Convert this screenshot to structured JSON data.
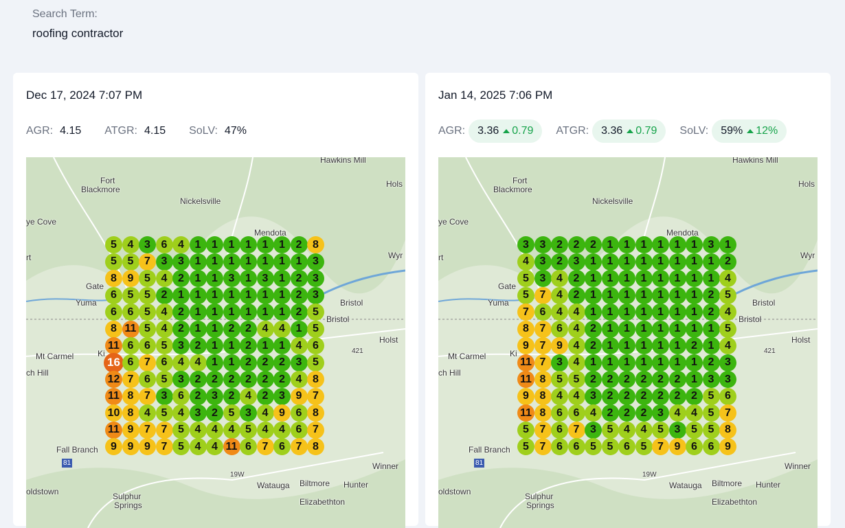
{
  "search": {
    "label": "Search Term:",
    "value": "roofing contractor"
  },
  "colors": {
    "rank_1_3": "#3cb50f",
    "rank_4_6": "#9fcf1c",
    "rank_7_10": "#f6c21a",
    "rank_11_15": "#f08a17",
    "rank_16_plus": "#e56417",
    "delta_up": "#16a34a",
    "pill_bg": "#e8f6ee"
  },
  "places": [
    "Hawkins Mill",
    "Hols",
    "Fort",
    "Blackmore",
    "Nickelsville",
    "ye Cove",
    "Mendota",
    "rt",
    "Wyr",
    "Gate",
    "Yuma",
    "Bristol",
    "Bristol",
    "Holst",
    "Mt Carmel",
    "Ki",
    "ch Hill",
    "421",
    "Fall Branch",
    "81",
    "19W",
    "Winner",
    "oldstown",
    "Watauga",
    "Biltmore",
    "Hunter",
    "Sulphur",
    "Springs",
    "Elizabethton"
  ],
  "scans": [
    {
      "date": "Dec 17, 2024 7:07 PM",
      "metrics": {
        "agr_label": "AGR:",
        "agr": "4.15",
        "atgr_label": "ATGR:",
        "atgr": "4.15",
        "solv_label": "SoLV:",
        "solv": "47%"
      },
      "grid": [
        [
          5,
          4,
          3,
          6,
          4,
          1,
          1,
          1,
          1,
          1,
          1,
          2,
          8
        ],
        [
          5,
          5,
          7,
          3,
          3,
          1,
          1,
          1,
          1,
          1,
          1,
          1,
          3
        ],
        [
          8,
          9,
          5,
          4,
          2,
          1,
          1,
          3,
          1,
          3,
          1,
          2,
          3
        ],
        [
          6,
          5,
          5,
          2,
          1,
          1,
          1,
          1,
          1,
          1,
          1,
          2,
          3
        ],
        [
          6,
          6,
          5,
          4,
          2,
          1,
          1,
          1,
          1,
          1,
          1,
          2,
          5
        ],
        [
          8,
          11,
          5,
          4,
          2,
          1,
          1,
          2,
          2,
          4,
          4,
          1,
          5
        ],
        [
          11,
          6,
          6,
          5,
          3,
          2,
          1,
          1,
          2,
          1,
          1,
          4,
          6
        ],
        [
          16,
          6,
          7,
          6,
          4,
          4,
          1,
          1,
          2,
          2,
          2,
          3,
          5
        ],
        [
          12,
          7,
          6,
          5,
          3,
          2,
          2,
          2,
          2,
          2,
          2,
          4,
          8
        ],
        [
          11,
          8,
          7,
          3,
          6,
          2,
          3,
          2,
          4,
          2,
          3,
          9,
          7
        ],
        [
          10,
          8,
          4,
          5,
          4,
          3,
          2,
          5,
          3,
          4,
          9,
          6,
          8
        ],
        [
          11,
          9,
          7,
          7,
          5,
          4,
          4,
          4,
          5,
          4,
          4,
          6,
          7
        ],
        [
          9,
          9,
          9,
          7,
          5,
          4,
          4,
          11,
          6,
          7,
          6,
          7,
          8
        ]
      ]
    },
    {
      "date": "Jan 14, 2025 7:06 PM",
      "metrics": {
        "agr_label": "AGR:",
        "agr": "3.36",
        "agr_delta": "0.79",
        "atgr_label": "ATGR:",
        "atgr": "3.36",
        "atgr_delta": "0.79",
        "solv_label": "SoLV:",
        "solv": "59%",
        "solv_delta": "12%"
      },
      "grid": [
        [
          3,
          3,
          2,
          2,
          2,
          1,
          1,
          1,
          1,
          1,
          1,
          3,
          1
        ],
        [
          4,
          3,
          2,
          3,
          1,
          1,
          1,
          1,
          1,
          1,
          1,
          1,
          2
        ],
        [
          5,
          3,
          4,
          2,
          1,
          1,
          1,
          1,
          1,
          1,
          1,
          1,
          4
        ],
        [
          5,
          7,
          4,
          2,
          1,
          1,
          1,
          1,
          1,
          1,
          1,
          2,
          5
        ],
        [
          7,
          6,
          4,
          4,
          1,
          1,
          1,
          1,
          1,
          1,
          1,
          2,
          4
        ],
        [
          8,
          7,
          6,
          4,
          2,
          1,
          1,
          1,
          1,
          1,
          1,
          1,
          5
        ],
        [
          9,
          7,
          9,
          4,
          2,
          1,
          1,
          1,
          1,
          1,
          2,
          1,
          4
        ],
        [
          11,
          7,
          3,
          4,
          1,
          1,
          1,
          1,
          1,
          1,
          1,
          2,
          3
        ],
        [
          11,
          8,
          5,
          5,
          2,
          2,
          2,
          2,
          2,
          2,
          1,
          3,
          3
        ],
        [
          9,
          8,
          4,
          4,
          3,
          2,
          2,
          2,
          2,
          2,
          2,
          5,
          6
        ],
        [
          11,
          8,
          6,
          6,
          4,
          2,
          2,
          2,
          3,
          4,
          4,
          5,
          7
        ],
        [
          5,
          7,
          6,
          7,
          3,
          5,
          4,
          4,
          5,
          3,
          5,
          5,
          8
        ],
        [
          5,
          7,
          6,
          6,
          5,
          5,
          6,
          5,
          7,
          9,
          6,
          6,
          9
        ]
      ]
    }
  ]
}
